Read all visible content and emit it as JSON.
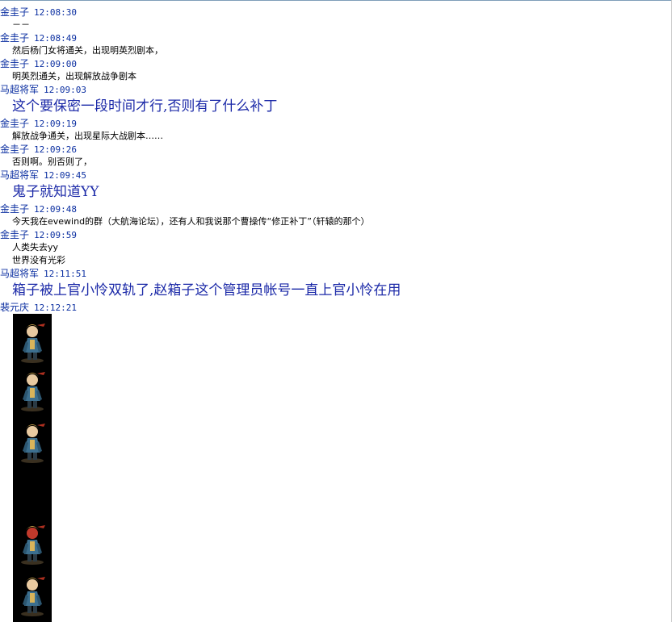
{
  "messages": [
    {
      "sender": "金圭子",
      "time": "12:08:30",
      "lines": [
        "－－"
      ],
      "style": "normal"
    },
    {
      "sender": "金圭子",
      "time": "12:08:49",
      "lines": [
        "然后杨门女将通关，出现明英烈剧本，"
      ],
      "style": "normal"
    },
    {
      "sender": "金圭子",
      "time": "12:09:00",
      "lines": [
        "明英烈通关，出现解放战争剧本"
      ],
      "style": "normal"
    },
    {
      "sender": "马超将军",
      "time": "12:09:03",
      "lines": [
        "这个要保密一段时间才行,否则有了什么补丁"
      ],
      "style": "big"
    },
    {
      "sender": "金圭子",
      "time": "12:09:19",
      "lines": [
        "解放战争通关，出现星际大战剧本……"
      ],
      "style": "normal"
    },
    {
      "sender": "金圭子",
      "time": "12:09:26",
      "lines": [
        "否则啊。别否则了，"
      ],
      "style": "normal"
    },
    {
      "sender": "马超将军",
      "time": "12:09:45",
      "lines": [
        "鬼子就知道YY"
      ],
      "style": "big"
    },
    {
      "sender": "金圭子",
      "time": "12:09:48",
      "lines": [
        "今天我在evewind的群（大航海论坛），还有人和我说那个曹操传“修正补丁”（轩辕的那个）"
      ],
      "style": "normal"
    },
    {
      "sender": "金圭子",
      "time": "12:09:59",
      "lines": [
        "人类失去yy",
        "世界没有光彩"
      ],
      "style": "normal"
    },
    {
      "sender": "马超将军",
      "time": "12:11:51",
      "lines": [
        "箱子被上官小怜双轨了,赵箱子这个管理员帐号一直上官小怜在用"
      ],
      "style": "big"
    },
    {
      "sender": "裴元庆",
      "time": "12:12:21",
      "lines": [],
      "style": "image"
    }
  ],
  "colors": {
    "header": "#0b2fa1",
    "big_text": "#1c2aa8",
    "normal_text": "#000000",
    "image_bg": "#000000"
  },
  "image_strip": {
    "description_icon": "general-sprite-icon"
  }
}
